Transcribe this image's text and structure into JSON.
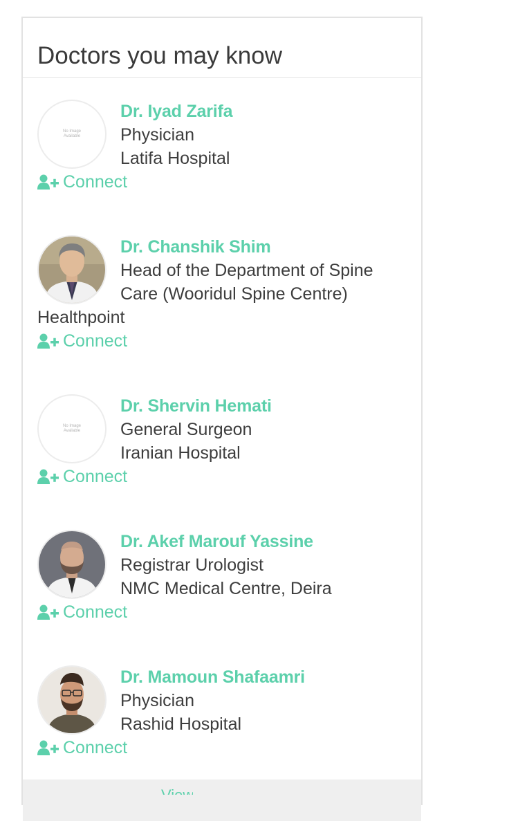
{
  "widget": {
    "title": "Doctors you may know",
    "connect_label": "Connect",
    "no_image_text": [
      "No Image",
      "Available"
    ],
    "more_label": "View"
  },
  "doctors": [
    {
      "name": "Dr. Iyad Zarifa",
      "role": "Physician",
      "facility": "Latifa Hospital",
      "photo": "none"
    },
    {
      "name": "Dr. Chanshik Shim",
      "role_lines": [
        "Head of the Department of Spine",
        "Care (Wooridul Spine Centre)"
      ],
      "facility": "Healthpoint",
      "photo": "man-white-coat-grey-hair"
    },
    {
      "name": "Dr. Shervin Hemati",
      "role": "General Surgeon",
      "facility": "Iranian Hospital",
      "photo": "none"
    },
    {
      "name": "Dr. Akef Marouf Yassine",
      "role": "Registrar Urologist",
      "facility": "NMC Medical Centre, Deira",
      "photo": "man-white-coat-bald"
    },
    {
      "name": "Dr. Mamoun Shafaamri",
      "role": "Physician",
      "facility": "Rashid Hospital",
      "photo": "man-glasses-beard"
    }
  ],
  "colors": {
    "accent": "#5cd0ab",
    "text": "#3d3d3d",
    "border": "#e2e2e2"
  },
  "icons": {
    "connect": "user-plus-icon"
  }
}
